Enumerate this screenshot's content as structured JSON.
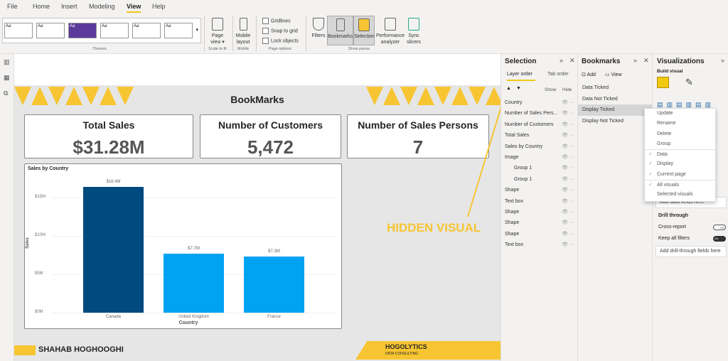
{
  "ribbon": {
    "menu": [
      "File",
      "Home",
      "Insert",
      "Modeling",
      "View",
      "Help"
    ],
    "active": "View",
    "groups": {
      "themes": "Themes",
      "scale": "Scale to fit",
      "mobile": "Mobile",
      "page_options": "Page options",
      "show_panes": "Show panes"
    },
    "theme_swatch_label": "Aa",
    "page_view": "Page view ▾",
    "mobile_layout": "Mobile layout",
    "checkboxes": [
      "Gridlines",
      "Snap to grid",
      "Lock objects"
    ],
    "panes": [
      "Filters",
      "Bookmarks",
      "Selection",
      "Performance analyzer",
      "Sync slicers"
    ]
  },
  "report": {
    "title": "BookMarks",
    "author": "SHAHAB HOGHOOGHI",
    "logo": "HOGOLYTICS DATA CONSULTING",
    "cards": [
      {
        "title": "Total Sales",
        "value": "$31.28M"
      },
      {
        "title": "Number of Customers",
        "value": "5,472"
      },
      {
        "title": "Number of Sales Persons",
        "value": "7"
      }
    ],
    "annotation": "HIDDEN VISUAL",
    "accent": "#f7c532"
  },
  "chart_data": {
    "type": "bar",
    "title": "Sales by Country",
    "xlabel": "Country",
    "ylabel": "Sales",
    "categories": [
      "Canada",
      "United Kingdom",
      "France"
    ],
    "values": [
      16.4,
      7.7,
      7.3
    ],
    "data_labels": [
      "$16.4M",
      "$7.7M",
      "$7.3M"
    ],
    "yticks": [
      0,
      5,
      10,
      15
    ],
    "ytick_labels": [
      "$0M",
      "$5M",
      "$10M",
      "$15M"
    ],
    "ylim": [
      0,
      17
    ],
    "colors": [
      "#004a7f",
      "#00a2f2",
      "#00a2f2"
    ],
    "grid": true
  },
  "selection": {
    "title": "Selection",
    "tabs": [
      "Layer order",
      "Tab order"
    ],
    "show": "Show",
    "hide": "Hide",
    "items": [
      "Country",
      "Number of Sales Pers...",
      "Number of Customers",
      "Total Sales",
      "Sales by Country",
      "Image",
      "Group 1",
      "Group 1",
      "Shape",
      "Text box",
      "Shape",
      "Shape",
      "Shape",
      "Text box"
    ]
  },
  "bookmarks": {
    "title": "Bookmarks",
    "add": "Add",
    "view": "View",
    "items": [
      "Data Ticked",
      "Data Not Ticked",
      "Display Ticked",
      "Display Not Ticked"
    ],
    "selected": "Display Ticked"
  },
  "context_menu": {
    "items": [
      "Update",
      "Rename",
      "Delete",
      "Group",
      "Data",
      "Display",
      "Current page",
      "All visuals",
      "Selected visuals"
    ],
    "checked": [
      "Data",
      "Display",
      "Current page",
      "All visuals"
    ]
  },
  "visualizations": {
    "title": "Visualizations",
    "build": "Build visual",
    "add_fields": "Add data fields here",
    "drill": "Drill through",
    "cross_report": "Cross-report",
    "cross_state": "Off",
    "keep_filters": "Keep all filters",
    "keep_state": "On",
    "add_drill": "Add drill-through fields here"
  }
}
